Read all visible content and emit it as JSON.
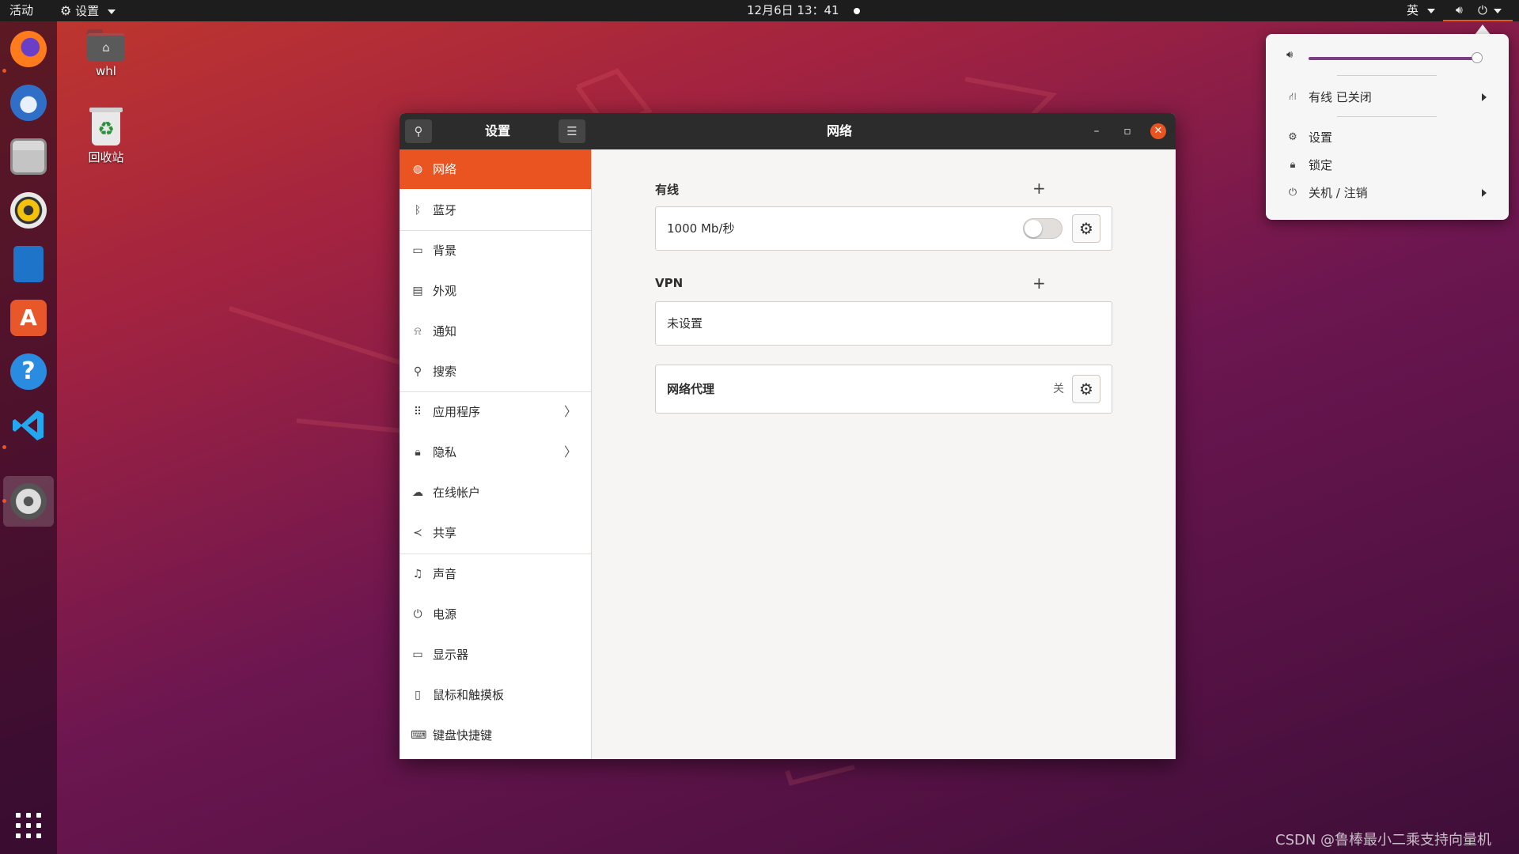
{
  "topbar": {
    "activities": "活动",
    "app_menu": "设置",
    "clock": "12月6日  13：41",
    "input_method": "英"
  },
  "dock": {
    "apps": [
      {
        "name": "Firefox",
        "icon": "firefox-icon",
        "running": true
      },
      {
        "name": "Thunderbird",
        "icon": "thunderbird-icon",
        "running": false
      },
      {
        "name": "Files",
        "icon": "files-icon",
        "running": false
      },
      {
        "name": "Rhythmbox",
        "icon": "rhythmbox-icon",
        "running": false
      },
      {
        "name": "LibreOffice Writer",
        "icon": "writer-icon",
        "running": false
      },
      {
        "name": "Ubuntu Software",
        "icon": "software-icon",
        "running": false
      },
      {
        "name": "Help",
        "icon": "help-icon",
        "running": false
      },
      {
        "name": "Visual Studio Code",
        "icon": "vscode-icon",
        "running": true
      },
      {
        "name": "Settings",
        "icon": "settings-icon",
        "running": true,
        "active": true
      }
    ],
    "show_apps_icon": "grid-icon"
  },
  "desktop": {
    "home_label": "whl",
    "trash_label": "回收站"
  },
  "window": {
    "sidebar_title": "设置",
    "page_title": "网络",
    "sidebar": {
      "items": [
        {
          "label": "网络",
          "icon": "network-icon",
          "active": true
        },
        {
          "label": "蓝牙",
          "icon": "bluetooth-icon"
        },
        {
          "label": "背景",
          "icon": "background-icon"
        },
        {
          "label": "外观",
          "icon": "appearance-icon"
        },
        {
          "label": "通知",
          "icon": "bell-icon"
        },
        {
          "label": "搜索",
          "icon": "search-icon"
        },
        {
          "label": "应用程序",
          "icon": "apps-icon",
          "has_arrow": true
        },
        {
          "label": "隐私",
          "icon": "lock-icon",
          "has_arrow": true
        },
        {
          "label": "在线帐户",
          "icon": "cloud-icon"
        },
        {
          "label": "共享",
          "icon": "share-icon"
        },
        {
          "label": "声音",
          "icon": "music-note-icon"
        },
        {
          "label": "电源",
          "icon": "power-icon"
        },
        {
          "label": "显示器",
          "icon": "display-icon"
        },
        {
          "label": "鼠标和触摸板",
          "icon": "mouse-icon"
        },
        {
          "label": "键盘快捷键",
          "icon": "keyboard-icon"
        }
      ]
    },
    "wired": {
      "title": "有线",
      "speed": "1000 Mb/秒",
      "enabled": false
    },
    "vpn": {
      "title": "VPN",
      "empty_text": "未设置"
    },
    "proxy": {
      "label": "网络代理",
      "status": "关"
    }
  },
  "system_menu": {
    "volume_level": 0.97,
    "wired_label": "有线 已关闭",
    "settings_label": "设置",
    "lock_label": "锁定",
    "power_label": "关机 / 注销"
  },
  "watermark": "CSDN @鲁棒最小二乘支持向量机",
  "colors": {
    "accent": "#e95420",
    "topbar": "#1d1d1d",
    "volume_fill": "#7c3f83"
  }
}
